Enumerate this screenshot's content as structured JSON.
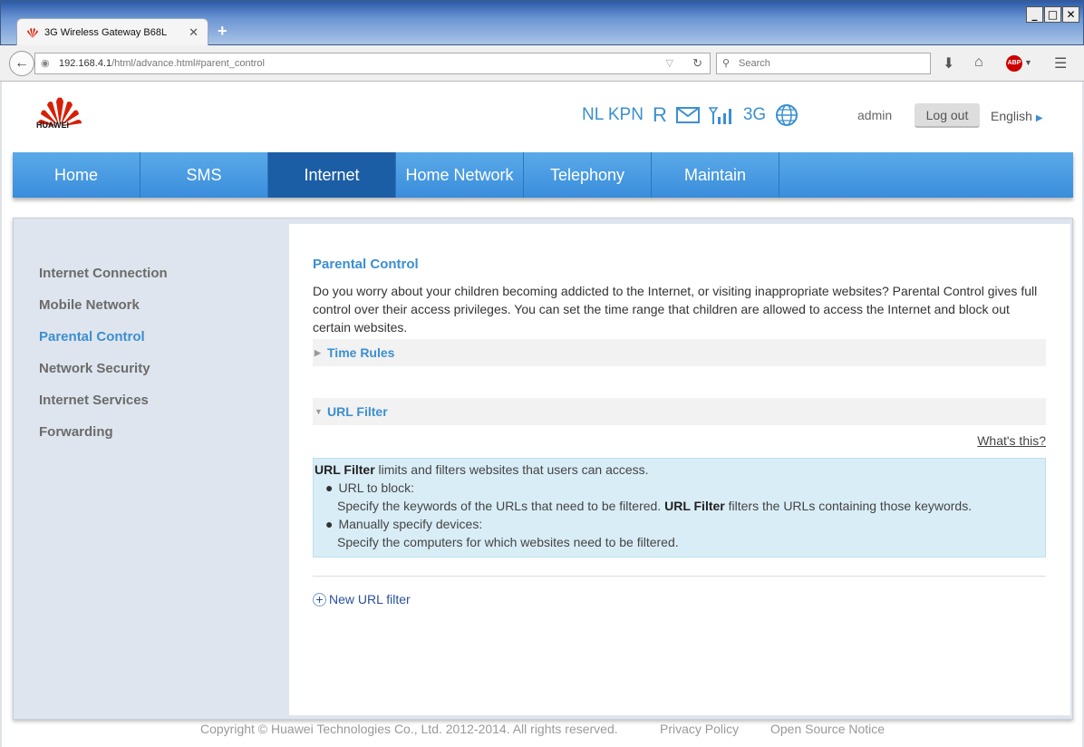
{
  "browser": {
    "tab_title": "3G Wireless Gateway B68L",
    "url_host": "192.168.4.1",
    "url_path": "/html/advance.html#parent_control",
    "search_placeholder": "Search",
    "win_buttons": [
      "_",
      "□",
      "✕"
    ]
  },
  "header": {
    "brand": "HUAWEI",
    "operator": "NL KPN",
    "roaming": "R",
    "network_type": "3G",
    "user": "admin",
    "logout_label": "Log out",
    "language": "English"
  },
  "nav": {
    "items": [
      "Home",
      "SMS",
      "Internet",
      "Home Network",
      "Telephony",
      "Maintain"
    ],
    "active": "Internet"
  },
  "sidebar": {
    "items": [
      "Internet Connection",
      "Mobile Network",
      "Parental Control",
      "Network Security",
      "Internet Services",
      "Forwarding"
    ],
    "active": "Parental Control"
  },
  "content": {
    "title": "Parental Control",
    "description": "Do you worry about your children becoming addicted to the Internet, or visiting inappropriate websites? Parental Control gives full control over their access privileges. You can set the time range that children are allowed to access the Internet and block out certain websites.",
    "time_rules_label": "Time Rules",
    "url_filter_label": "URL Filter",
    "whats_this": "What's this?",
    "info": {
      "lead_bold": "URL Filter",
      "lead_rest": " limits and filters websites that users can access.",
      "item1_title": "URL to block:",
      "item1_desc_a": "Specify the keywords of the URLs that need to be filtered. ",
      "item1_desc_bold": "URL Filter",
      "item1_desc_b": " filters the URLs containing those keywords.",
      "item2_title": "Manually specify devices:",
      "item2_desc": "Specify the computers for which websites need to be filtered."
    },
    "new_filter_label": "New URL filter"
  },
  "footer": {
    "copyright": "Copyright © Huawei Technologies Co., Ltd. 2012-2014. All rights reserved.",
    "privacy": "Privacy Policy",
    "open_source": "Open Source Notice"
  },
  "colors": {
    "accent": "#3b8fd1",
    "nav_active": "#1c5ea6",
    "info_bg": "#d9edf7"
  }
}
